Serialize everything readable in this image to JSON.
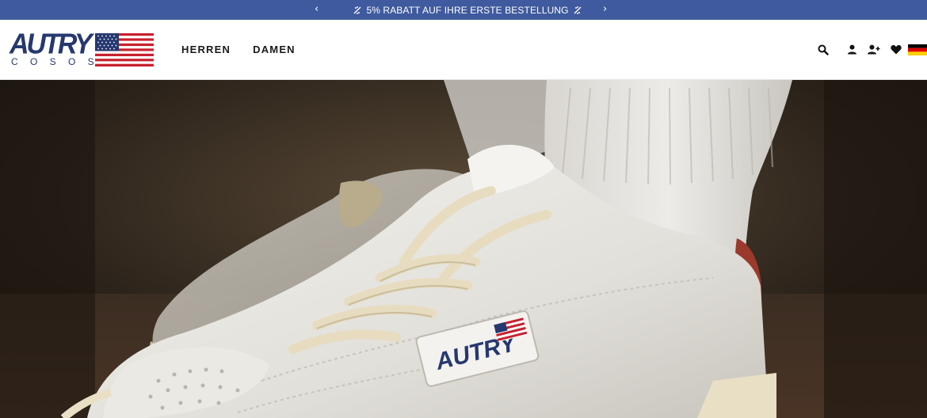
{
  "announcement": {
    "text": "5% RABATT AUF IHRE ERSTE BESTELLUNG",
    "prev_arrow": "‹",
    "next_arrow": "›",
    "background": "#3f5a9e"
  },
  "logo": {
    "wordmark": "AUTRY",
    "subline": "C O S O S ®",
    "brand_color": "#263870"
  },
  "nav": {
    "items": [
      {
        "label": "HERREN"
      },
      {
        "label": "DAMEN"
      }
    ]
  },
  "header_icons": [
    "search-icon",
    "account-icon",
    "register-icon",
    "wishlist-heart-icon",
    "germany-flag-icon"
  ],
  "hero": {
    "image": "close-up of white leather sneakers with cream laces and white socks",
    "badge_text": "AUTRY"
  }
}
